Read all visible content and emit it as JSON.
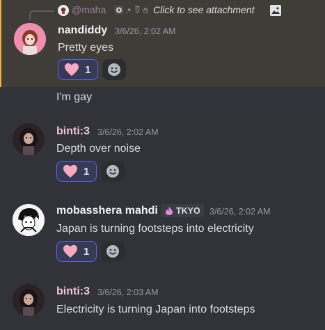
{
  "reply": {
    "username": "@maha",
    "text": "Click to see attachment",
    "icon": "image-icon"
  },
  "messages": [
    {
      "username": "nandiddy",
      "username_color": "#f2f3f5",
      "timestamp": "3/6/26, 2:02 AM",
      "text": "Pretty eyes",
      "reaction": {
        "emoji": "heart",
        "count": "1"
      }
    },
    {
      "continuation_text": "I'm gay"
    },
    {
      "username": "binti:3",
      "username_color": "#f0c5d8",
      "timestamp": "3/6/26, 2:02 AM",
      "text": "Depth over noise",
      "reaction": {
        "emoji": "heart",
        "count": "1"
      }
    },
    {
      "username": "mobasshera mahdi",
      "username_color": "#f2f3f5",
      "tag": "TKYO",
      "timestamp": "3/6/26, 2:02 AM",
      "text": "Japan is turning footsteps into electricity",
      "reaction": {
        "emoji": "heart",
        "count": "1"
      }
    },
    {
      "username": "binti:3",
      "username_color": "#f0c5d8",
      "timestamp": "3/6/26, 2:03 AM",
      "text": "Electricity is turning Japan into footsteps"
    }
  ],
  "colors": {
    "background": "#313338",
    "highlight": "#403d38",
    "highlight_border": "#f0b232",
    "reaction_bg": "#373a53",
    "reaction_border": "#5865f2",
    "heart": "#f7a8c2"
  }
}
